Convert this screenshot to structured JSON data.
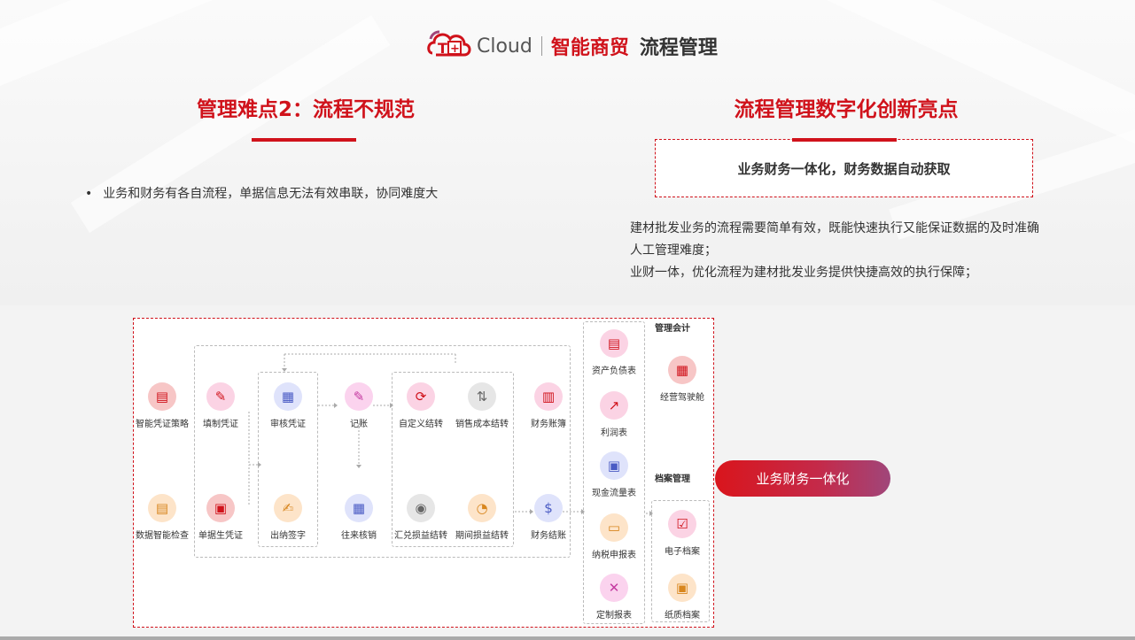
{
  "header": {
    "cloud_text": "Cloud",
    "brand": "智能商贸",
    "title": "流程管理"
  },
  "left": {
    "heading": "管理难点2：流程不规范",
    "bullet_mark": "•",
    "bullet": "业务和财务有各自流程，单据信息无法有效串联，协同难度大"
  },
  "right": {
    "heading": "流程管理数字化创新亮点",
    "highlight": "业务财务一体化，财务数据自动获取",
    "desc": [
      "建材批发业务的流程需要简单有效，既能快速执行又能保证数据的及时准确",
      "人工管理难度；",
      "业财一体，优化流程为建材批发业务提供快捷高效的执行保障；"
    ]
  },
  "flow": {
    "nodes": [
      {
        "label": "智能凭证策略",
        "icon": "voucher-policy-icon",
        "color": "#f7c6c6",
        "glyph": "▤"
      },
      {
        "label": "填制凭证",
        "icon": "fill-voucher-icon",
        "color": "#fbd3e4",
        "glyph": "✎"
      },
      {
        "label": "审核凭证",
        "icon": "audit-voucher-icon",
        "color": "#dfe3fb",
        "glyph": "▦"
      },
      {
        "label": "记账",
        "icon": "bookkeeping-icon",
        "color": "#fbd3ee",
        "glyph": "✎"
      },
      {
        "label": "自定义结转",
        "icon": "custom-transfer-icon",
        "color": "#fbd3e4",
        "glyph": "⟳"
      },
      {
        "label": "销售成本结转",
        "icon": "sales-cost-transfer-icon",
        "color": "#e6e6e6",
        "glyph": "⇅"
      },
      {
        "label": "财务账簿",
        "icon": "ledger-icon",
        "color": "#fbd3e4",
        "glyph": "▥"
      },
      {
        "label": "数据智能检查",
        "icon": "data-check-icon",
        "color": "#fde4c9",
        "glyph": "▤"
      },
      {
        "label": "单据生凭证",
        "icon": "document-voucher-icon",
        "color": "#f7c6c6",
        "glyph": "▣"
      },
      {
        "label": "出纳签字",
        "icon": "cashier-sign-icon",
        "color": "#fde4c9",
        "glyph": "✍"
      },
      {
        "label": "往来核销",
        "icon": "writeoff-icon",
        "color": "#dfe3fb",
        "glyph": "▦"
      },
      {
        "label": "汇兑损益结转",
        "icon": "exchange-transfer-icon",
        "color": "#e6e6e6",
        "glyph": "◉"
      },
      {
        "label": "期间损益结转",
        "icon": "period-transfer-icon",
        "color": "#fde4c9",
        "glyph": "◔"
      },
      {
        "label": "财务结账",
        "icon": "closing-icon",
        "color": "#dfe3fb",
        "glyph": "$"
      }
    ],
    "reports": [
      {
        "label": "资产负债表",
        "icon": "balance-sheet-icon",
        "color": "#fbd3e4",
        "glyph": "▤"
      },
      {
        "label": "利润表",
        "icon": "income-statement-icon",
        "color": "#fbd3e4",
        "glyph": "↗"
      },
      {
        "label": "现金流量表",
        "icon": "cash-flow-icon",
        "color": "#dfe3fb",
        "glyph": "▣"
      },
      {
        "label": "纳税申报表",
        "icon": "tax-return-icon",
        "color": "#fde4c9",
        "glyph": "▭"
      },
      {
        "label": "定制报表",
        "icon": "custom-report-icon",
        "color": "#fbd3ee",
        "glyph": "✕"
      }
    ],
    "mgmt_title": "管理会计",
    "mgmt_item": {
      "label": "经营驾驶舱",
      "icon": "cockpit-icon",
      "color": "#f7c6c6",
      "glyph": "▦"
    },
    "archive_title": "档案管理",
    "archive_items": [
      {
        "label": "电子档案",
        "icon": "e-archive-icon",
        "color": "#fbd3e4",
        "glyph": "☑"
      },
      {
        "label": "纸质档案",
        "icon": "paper-archive-icon",
        "color": "#fde4c9",
        "glyph": "▣"
      }
    ]
  },
  "pill": "业务财务一体化"
}
